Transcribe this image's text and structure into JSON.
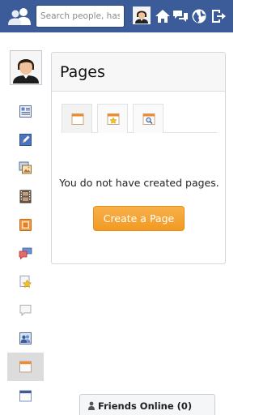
{
  "topbar": {
    "search_placeholder": "Search people, hasht"
  },
  "panel": {
    "title": "Pages",
    "empty_message": "You do not have created pages.",
    "create_button": "Create a Page"
  },
  "friends_online": {
    "label": "Friends Online (0)"
  },
  "colors": {
    "topbar": "#3b5b99",
    "accent_orange": "#f29a23",
    "rail_active": "#dcdcdc"
  },
  "icons": {
    "rail": [
      "news-feed-icon",
      "edit-icon",
      "photos-icon",
      "videos-icon",
      "pages-icon",
      "messages-icon",
      "favorites-icon",
      "chat-icon",
      "groups-icon",
      "pages-active-icon",
      "window-icon"
    ],
    "tabs": [
      "my-pages-icon",
      "liked-pages-icon",
      "search-pages-icon"
    ]
  }
}
